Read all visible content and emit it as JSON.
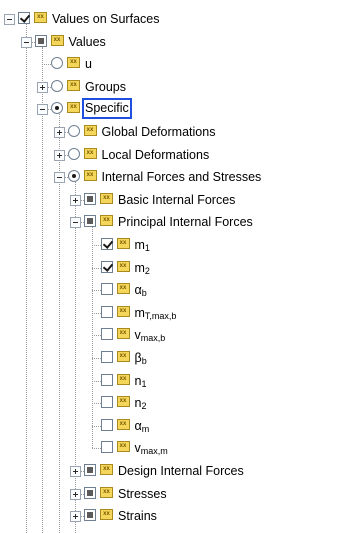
{
  "tree": {
    "items": [
      {
        "label": "Values on Surfaces",
        "expander": "minus",
        "control": "checkbox",
        "state": "checked",
        "level": 0,
        "icon": "result-icon"
      },
      {
        "label": "Values",
        "expander": "minus",
        "control": "checkbox",
        "state": "partial",
        "level": 1,
        "icon": "result-icon"
      },
      {
        "label": "u",
        "expander": "none",
        "control": "radio",
        "state": "off",
        "level": 2,
        "icon": "result-icon"
      },
      {
        "label": "Groups",
        "expander": "plus",
        "control": "radio",
        "state": "off",
        "level": 2,
        "icon": "result-icon"
      },
      {
        "label": "Specific",
        "expander": "minus",
        "control": "radio",
        "state": "on",
        "level": 2,
        "selected": true,
        "icon": "result-icon"
      },
      {
        "label": "Global Deformations",
        "expander": "plus",
        "control": "radio",
        "state": "off",
        "level": 3,
        "icon": "result-icon"
      },
      {
        "label": "Local Deformations",
        "expander": "plus",
        "control": "radio",
        "state": "off",
        "level": 3,
        "icon": "result-icon"
      },
      {
        "label": "Internal Forces and Stresses",
        "expander": "minus",
        "control": "radio",
        "state": "on",
        "level": 3,
        "icon": "result-icon"
      },
      {
        "label": "Basic Internal Forces",
        "expander": "plus",
        "control": "checkbox",
        "state": "partial",
        "level": 4,
        "icon": "result-icon"
      },
      {
        "label": "Principal Internal Forces",
        "expander": "minus",
        "control": "checkbox",
        "state": "partial",
        "level": 4,
        "icon": "result-icon"
      },
      {
        "label": "m",
        "sub": "1",
        "expander": "none",
        "control": "checkbox",
        "state": "checked",
        "level": 5,
        "icon": "result-icon"
      },
      {
        "label": "m",
        "sub": "2",
        "expander": "none",
        "control": "checkbox",
        "state": "checked",
        "level": 5,
        "icon": "result-icon"
      },
      {
        "label": "α",
        "sub": "b",
        "expander": "none",
        "control": "checkbox",
        "state": "unchecked",
        "level": 5,
        "icon": "result-icon"
      },
      {
        "label": "m",
        "sub": "T,max,b",
        "expander": "none",
        "control": "checkbox",
        "state": "unchecked",
        "level": 5,
        "icon": "result-icon"
      },
      {
        "label": "v",
        "sub": "max,b",
        "expander": "none",
        "control": "checkbox",
        "state": "unchecked",
        "level": 5,
        "icon": "result-icon"
      },
      {
        "label": "β",
        "sub": "b",
        "expander": "none",
        "control": "checkbox",
        "state": "unchecked",
        "level": 5,
        "icon": "result-icon"
      },
      {
        "label": "n",
        "sub": "1",
        "expander": "none",
        "control": "checkbox",
        "state": "unchecked",
        "level": 5,
        "icon": "result-icon"
      },
      {
        "label": "n",
        "sub": "2",
        "expander": "none",
        "control": "checkbox",
        "state": "unchecked",
        "level": 5,
        "icon": "result-icon"
      },
      {
        "label": "α",
        "sub": "m",
        "expander": "none",
        "control": "checkbox",
        "state": "unchecked",
        "level": 5,
        "icon": "result-icon"
      },
      {
        "label": "v",
        "sub": "max,m",
        "expander": "none",
        "control": "checkbox",
        "state": "unchecked",
        "level": 5,
        "icon": "result-icon"
      },
      {
        "label": "Design Internal Forces",
        "expander": "plus",
        "control": "checkbox",
        "state": "partial",
        "level": 4,
        "icon": "result-icon"
      },
      {
        "label": "Stresses",
        "expander": "plus",
        "control": "checkbox",
        "state": "partial",
        "level": 4,
        "icon": "result-icon"
      },
      {
        "label": "Strains",
        "expander": "plus",
        "control": "checkbox",
        "state": "partial",
        "level": 4,
        "icon": "result-icon"
      }
    ]
  },
  "colors": {
    "selection_outline": "#1f4fe0",
    "result_icon_fill": "#f3d65a",
    "tree_lines": "#9a9a9a"
  }
}
